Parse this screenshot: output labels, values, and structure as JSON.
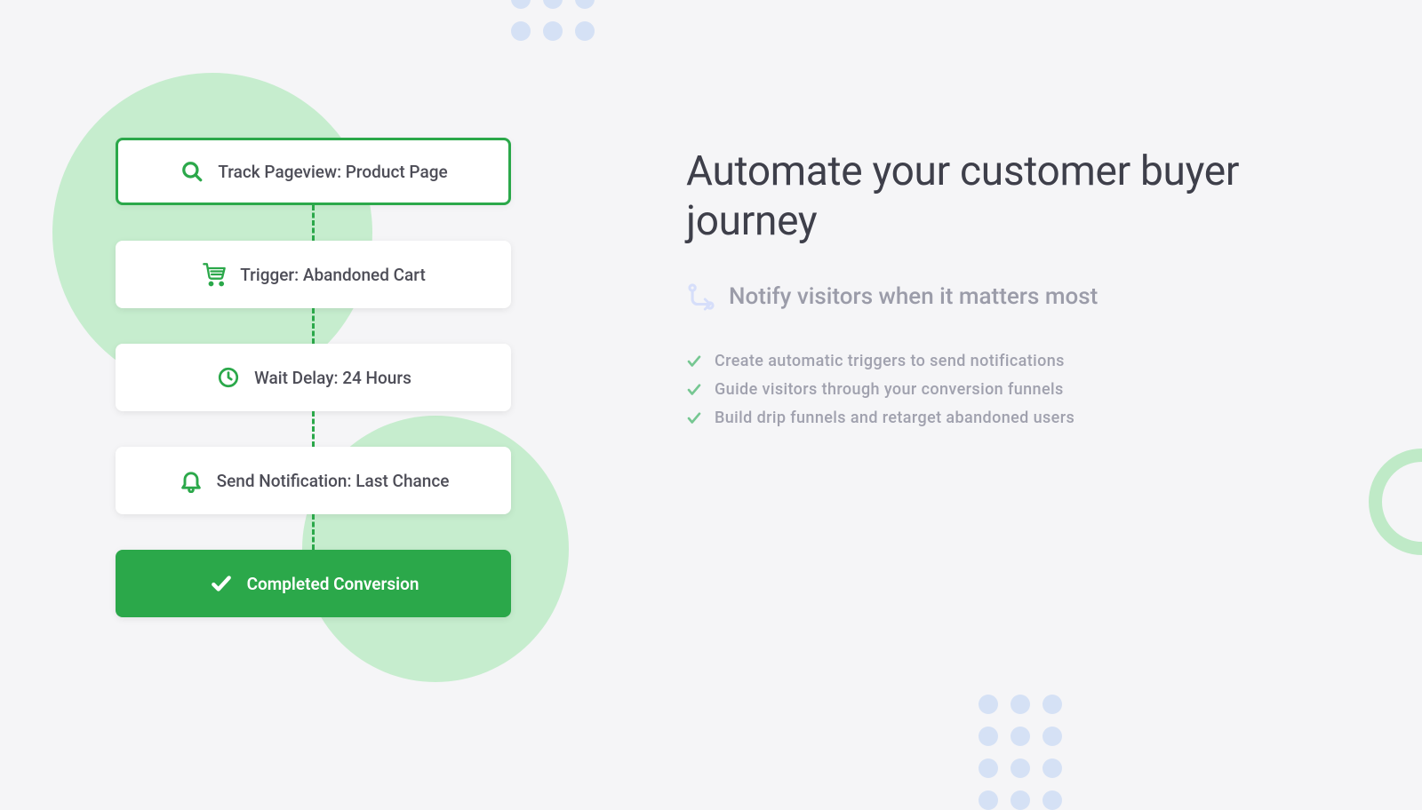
{
  "flow": {
    "steps": [
      {
        "label": "Track Pageview: Product Page"
      },
      {
        "label": "Trigger: Abandoned Cart"
      },
      {
        "label": "Wait Delay: 24 Hours"
      },
      {
        "label": "Send Notification: Last Chance"
      },
      {
        "label": "Completed Conversion"
      }
    ]
  },
  "content": {
    "headline": "Automate your customer buyer journey",
    "subtitle": "Notify visitors when it matters most",
    "features": [
      "Create automatic triggers to send notifications",
      "Guide visitors through your conversion funnels",
      "Build drip funnels and retarget abandoned users"
    ]
  },
  "colors": {
    "accent": "#2ba84a",
    "accentLight": "#c6edce",
    "dots": "#d5e1f5"
  }
}
